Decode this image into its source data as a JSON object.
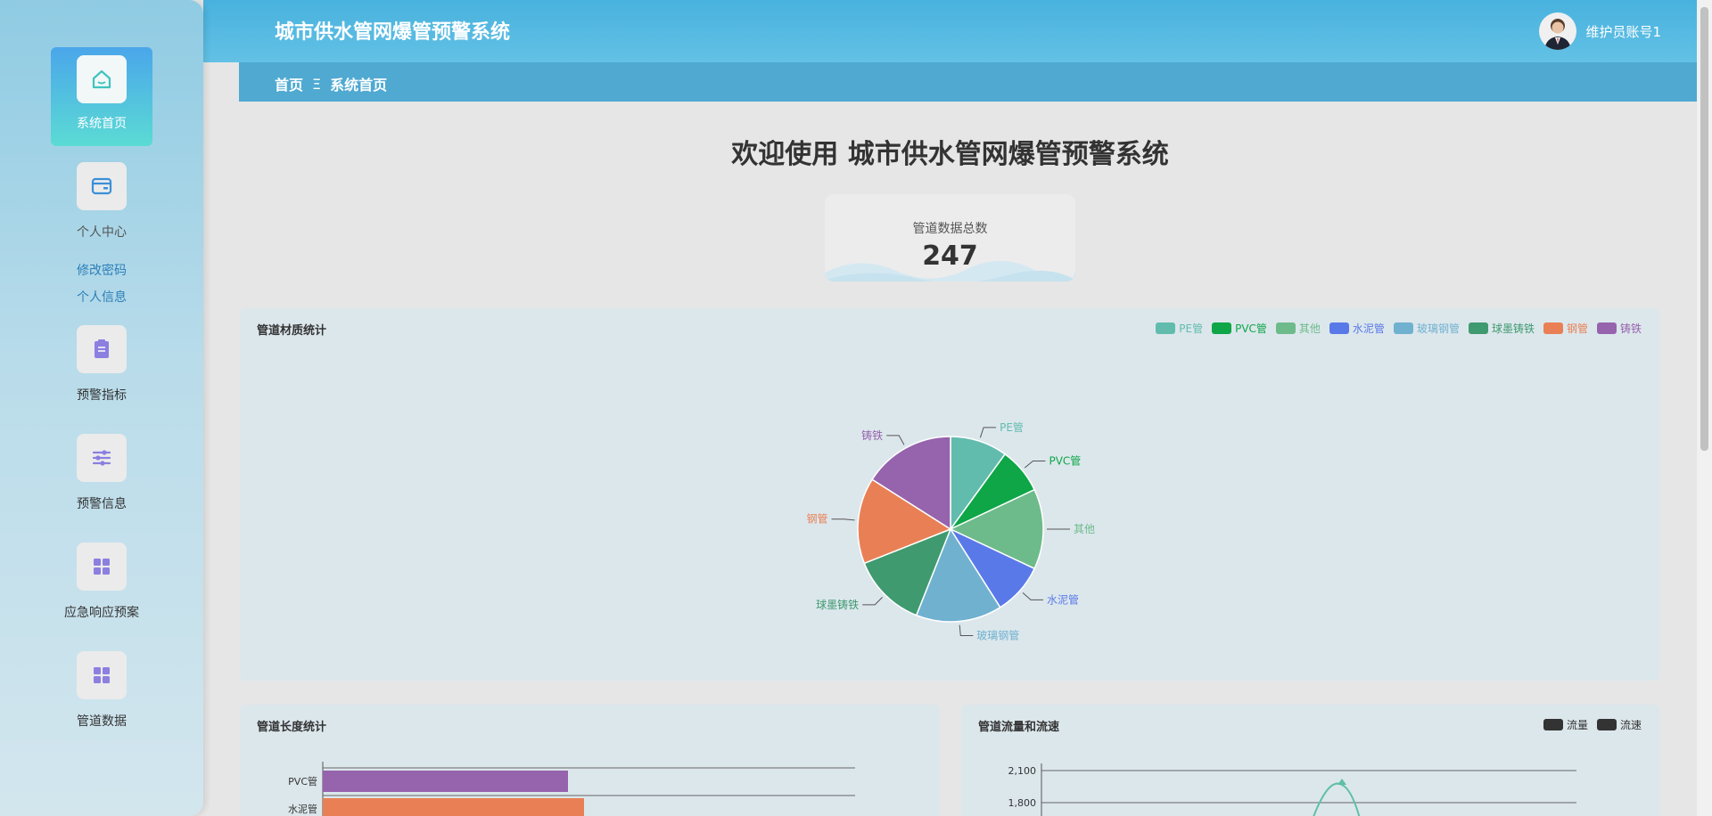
{
  "sidebar": {
    "items": [
      {
        "label": "系统首页",
        "icon": "home-icon"
      },
      {
        "label": "个人中心",
        "icon": "wallet-icon"
      },
      {
        "label": "预警指标",
        "icon": "clipboard-icon"
      },
      {
        "label": "预警信息",
        "icon": "sliders-icon"
      },
      {
        "label": "应急响应预案",
        "icon": "grid-icon"
      },
      {
        "label": "管道数据",
        "icon": "grid-icon"
      }
    ],
    "sub_links": [
      "修改密码",
      "个人信息"
    ]
  },
  "header": {
    "title": "城市供水管网爆管预警系统",
    "user_name": "维护员账号1"
  },
  "breadcrumb": {
    "home": "首页",
    "separator": "Ξ",
    "current": "系统首页"
  },
  "main": {
    "welcome_title": "欢迎使用 城市供水管网爆管预警系统",
    "stat": {
      "label": "管道数据总数",
      "value": "247"
    }
  },
  "chart_data": [
    {
      "type": "pie",
      "title": "管道材质统计",
      "categories": [
        "PE管",
        "PVC管",
        "其他",
        "水泥管",
        "玻璃钢管",
        "球墨铸铁",
        "钢管",
        "铸铁"
      ],
      "values": [
        10,
        8,
        14,
        9,
        15,
        13,
        15,
        16
      ],
      "colors": [
        "#62bcae",
        "#0ea647",
        "#6dbb8a",
        "#5a79e8",
        "#70b1d0",
        "#3f9a6f",
        "#e98055",
        "#9663ad"
      ],
      "legend": "top-right"
    },
    {
      "type": "bar",
      "title": "管道长度统计",
      "orientation": "horizontal",
      "categories": [
        "PVC管",
        "水泥管"
      ],
      "values": [
        275,
        293
      ],
      "colors": [
        "#9663ad",
        "#e98055"
      ]
    },
    {
      "type": "line",
      "title": "管道流量和流速",
      "series": [
        {
          "name": "流量"
        },
        {
          "name": "流速"
        }
      ],
      "yticks": [
        "2,100",
        "1,800"
      ],
      "legend": "top-right"
    }
  ]
}
